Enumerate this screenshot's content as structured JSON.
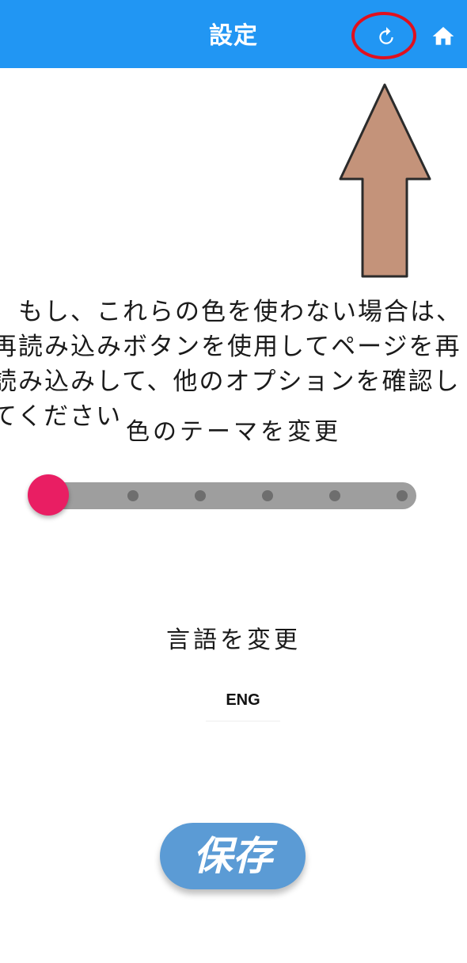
{
  "appbar": {
    "title": "設定",
    "reload_icon": "reload-icon",
    "home_icon": "home-icon",
    "background": "#2196F3"
  },
  "annotation": {
    "arrow_color": "#C4937A",
    "highlight_color": "#E0101E"
  },
  "info": {
    "text": "　もし、これらの色を使わない場合は、再読み込みボタンを使用してページを再読み込みして、他のオプションを確認してください"
  },
  "theme": {
    "label": "色のテーマを変更",
    "slider_steps": 6,
    "slider_value": 0,
    "thumb_color": "#E91E63"
  },
  "language": {
    "label": "言語を変更",
    "selected": "ENG"
  },
  "save": {
    "label": "保存",
    "color": "#5B9BD5"
  }
}
